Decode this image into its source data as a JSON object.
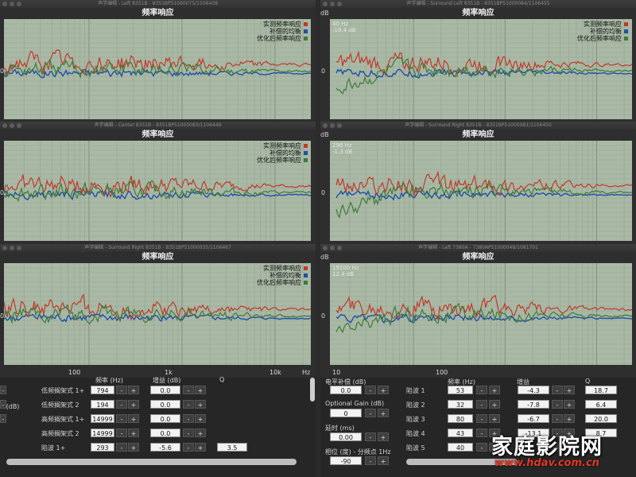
{
  "chart_title": "频率响应",
  "legend": [
    {
      "label": "实测频率响应",
      "color": "#c0392b"
    },
    {
      "label": "补偿的均衡",
      "color": "#1f4fa8"
    },
    {
      "label": "优化后频率响应",
      "color": "#3f7a3a"
    }
  ],
  "windows": [
    {
      "title": "声学编辑 - Left 8351B - 8351BP51000075/1106438",
      "y_label": "",
      "marker": "",
      "zero_label": "0"
    },
    {
      "title": "声学编辑 - Surround Left 8351B - 8351BP51000084/1106455",
      "y_label": "dB",
      "marker": "40 Hz\n-19.4 dB",
      "zero_label": "0"
    },
    {
      "title": "声学编辑 - Center 8351B - 8351BP51000083/1106449",
      "y_label": "",
      "marker": "",
      "zero_label": "0"
    },
    {
      "title": "声学编辑 - Surround Right 8351B - 8351BP51000081/1106450",
      "y_label": "dB",
      "marker": "296 Hz\n-1.3 dB",
      "zero_label": "0"
    },
    {
      "title": "声学编辑 - Surround Right 8351B - 8351BP51000035/1106467",
      "y_label": "",
      "marker": "",
      "zero_label": "0"
    },
    {
      "title": "声学编辑 - Left 7380A - 7380AP51000048/1081701",
      "y_label": "dB",
      "marker": "19100 Hz\n12.4 dB",
      "zero_label": "0"
    }
  ],
  "x_ticks_left": [
    "100",
    "1k",
    "10k",
    "Hz"
  ],
  "x_ticks_right": [
    "10",
    "100"
  ],
  "left_panel": {
    "headers": {
      "freq": "频率 (Hz)",
      "gain": "增益 (dB)",
      "q": "Q"
    },
    "partial_labels": [
      "n (dB)"
    ],
    "rows": [
      {
        "label": "低频搁架式 1+",
        "freq": "794",
        "gain": "0.0",
        "q": ""
      },
      {
        "label": "低频搁架式 2",
        "freq": "194",
        "gain": "0.0",
        "q": ""
      },
      {
        "label": "高频搁架式 1+",
        "freq": "14999",
        "gain": "0.0",
        "q": ""
      },
      {
        "label": "高频搁架式 2",
        "freq": "14999",
        "gain": "0.0",
        "q": ""
      },
      {
        "label": "陷波 1+",
        "freq": "293",
        "gain": "-5.6",
        "q": "3.5"
      }
    ]
  },
  "right_panel": {
    "level_label": "电平补偿 (dB)",
    "level_value": "0.0",
    "gain_label": "Optional Gain (dB)",
    "gain_value": "0",
    "delay_label": "延时 (ms)",
    "delay_value": "0.00",
    "phase_label": "相位 (度) - 分频点 1Hz",
    "phase_value": "-90",
    "headers": {
      "freq": "频率 (Hz)",
      "gain": "增益",
      "q": "Q"
    },
    "rows": [
      {
        "label": "陷波 1",
        "freq": "53",
        "gain": "-4.3",
        "q": "18.7"
      },
      {
        "label": "陷波 2",
        "freq": "32",
        "gain": "-7.8",
        "q": "6.4"
      },
      {
        "label": "陷波 3",
        "freq": "80",
        "gain": "-6.7",
        "q": "20.0"
      },
      {
        "label": "陷波 4",
        "freq": "43",
        "gain": "-13.1",
        "q": "8.7"
      },
      {
        "label": "陷波 5",
        "freq": "40",
        "gain": "",
        "q": ""
      }
    ]
  },
  "stepper": {
    "minus": "-",
    "plus": "+"
  },
  "watermark": {
    "main": "家庭影院网",
    "url": "www.hdav.com.cn"
  }
}
